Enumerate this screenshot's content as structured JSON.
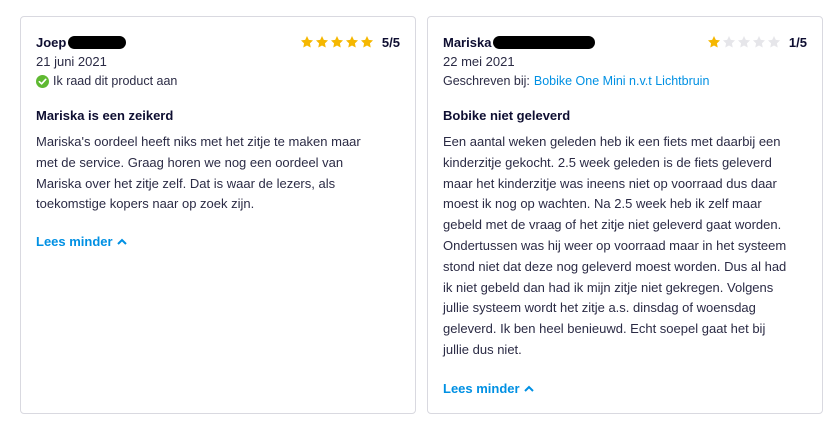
{
  "reviews": [
    {
      "name": "Joep",
      "score": "5/5",
      "stars": 5,
      "date": "21 juni 2021",
      "recommend": "Ik raad dit product aan",
      "title": "Mariska is een zeikerd",
      "body_lines": [
        "Mariska's oordeel heeft niks met het zitje te maken maar",
        "met de service. Graag horen we nog een oordeel van",
        "Mariska over het zitje zelf. Dat is waar de lezers, als",
        "toekomstige kopers naar op zoek zijn."
      ],
      "more": "Lees minder"
    },
    {
      "name": "Mariska",
      "score": "1/5",
      "stars": 1,
      "date": "22 mei 2021",
      "written_for_label": "Geschreven bij:",
      "written_for_product": "Bobike One Mini n.v.t Lichtbruin",
      "title": "Bobike niet geleverd",
      "body_lines": [
        "Een aantal weken geleden heb ik een fiets met daarbij een",
        "kinderzitje gekocht. 2.5 week geleden is de fiets geleverd",
        "maar het kinderzitje was ineens niet op voorraad dus daar",
        "moest ik nog op wachten. Na 2.5 week heb ik zelf maar",
        "gebeld met de vraag of het zitje niet geleverd gaat worden.",
        "Ondertussen was hij weer op voorraad maar in het systeem",
        "stond niet dat deze nog geleverd moest worden. Dus al had",
        "ik niet gebeld dan had ik mijn zitje niet gekregen. Volgens",
        "jullie systeem wordt het zitje a.s. dinsdag of woensdag",
        "geleverd. Ik ben heel benieuwd. Echt soepel gaat het bij",
        "jullie dus niet."
      ],
      "more": "Lees minder"
    }
  ],
  "colors": {
    "star_on": "#f5b700",
    "star_off": "#e6e6ea",
    "link": "#0090e3",
    "check": "#5fb932"
  }
}
